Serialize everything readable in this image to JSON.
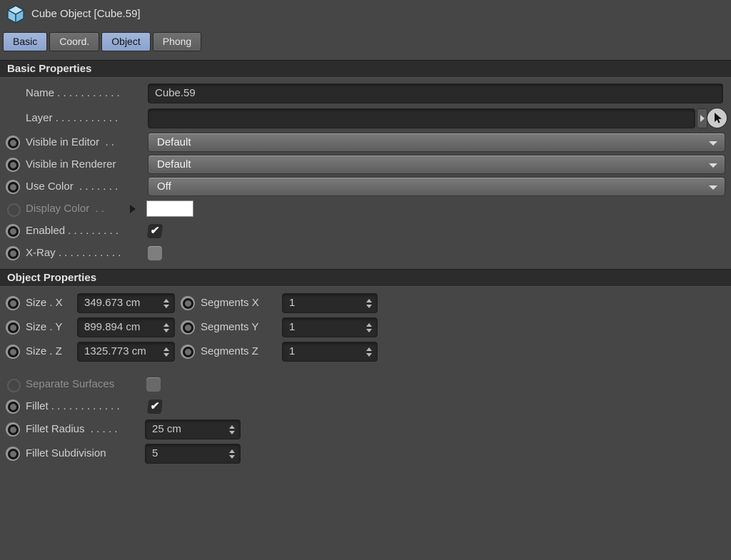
{
  "window": {
    "title": "Cube Object [Cube.59]"
  },
  "tabs": [
    {
      "label": "Basic",
      "selected": true
    },
    {
      "label": "Coord.",
      "selected": false
    },
    {
      "label": "Object",
      "selected": true
    },
    {
      "label": "Phong",
      "selected": false
    }
  ],
  "colors": {
    "background": "#464646",
    "section_header_bg": "#2c2c2c",
    "field_bg": "#292929",
    "selected_tab": "#93aad4",
    "cube_icon_blue": "#8cc9e8"
  },
  "sections": {
    "basic": {
      "title": "Basic Properties",
      "rows": {
        "name": {
          "label": "Name . . . . . . . . . . .",
          "value": "Cube.59"
        },
        "layer": {
          "label": "Layer . . . . . . . . . . .",
          "value": ""
        },
        "visible_editor": {
          "label": "Visible in Editor  . .",
          "value": "Default"
        },
        "visible_renderer": {
          "label": "Visible in Renderer",
          "value": "Default"
        },
        "use_color": {
          "label": "Use Color  . . . . . . .",
          "value": "Off"
        },
        "display_color": {
          "label": "Display Color  . .",
          "swatch_color": "#ffffff"
        },
        "enabled": {
          "label": "Enabled . . . . . . . . .",
          "checked": true,
          "check": "✔"
        },
        "xray": {
          "label": "X-Ray . . . . . . . . . . .",
          "checked": false,
          "check": ""
        }
      }
    },
    "object": {
      "title": "Object Properties",
      "rows": {
        "size_x": {
          "label": "Size . X",
          "value": "349.673 cm"
        },
        "size_y": {
          "label": "Size . Y",
          "value": "899.894 cm"
        },
        "size_z": {
          "label": "Size . Z",
          "value": "1325.773 cm"
        },
        "segments_x": {
          "label": "Segments X",
          "value": "1"
        },
        "segments_y": {
          "label": "Segments Y",
          "value": "1"
        },
        "segments_z": {
          "label": "Segments Z",
          "value": "1"
        },
        "separate_surfaces": {
          "label": "Separate Surfaces",
          "checked": false,
          "check": ""
        },
        "fillet": {
          "label": "Fillet . . . . . . . . . . . .",
          "checked": true,
          "check": "✔"
        },
        "fillet_radius": {
          "label": "Fillet Radius  . . . . .",
          "value": "25 cm"
        },
        "fillet_subdivision": {
          "label": "Fillet Subdivision",
          "value": "5"
        }
      }
    }
  }
}
